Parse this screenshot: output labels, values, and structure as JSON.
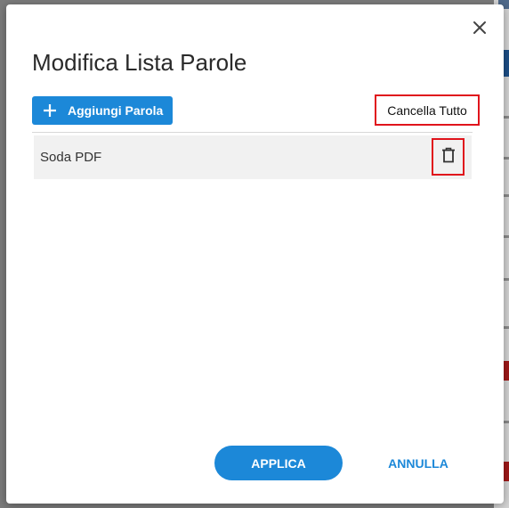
{
  "dialog": {
    "title": "Modifica Lista Parole",
    "close_icon": "close-icon",
    "add_button_label": "Aggiungi Parola",
    "add_icon": "plus-icon",
    "clear_all_label": "Cancella Tutto",
    "words": [
      {
        "text": "Soda PDF",
        "delete_icon": "trash-icon"
      }
    ],
    "apply_label": "APPLICA",
    "cancel_label": "ANNULLA"
  },
  "colors": {
    "accent": "#1c88d8",
    "highlight_border": "#e0141c",
    "overlay": "#7b7b7b",
    "list_item_bg": "#f1f1f1"
  }
}
